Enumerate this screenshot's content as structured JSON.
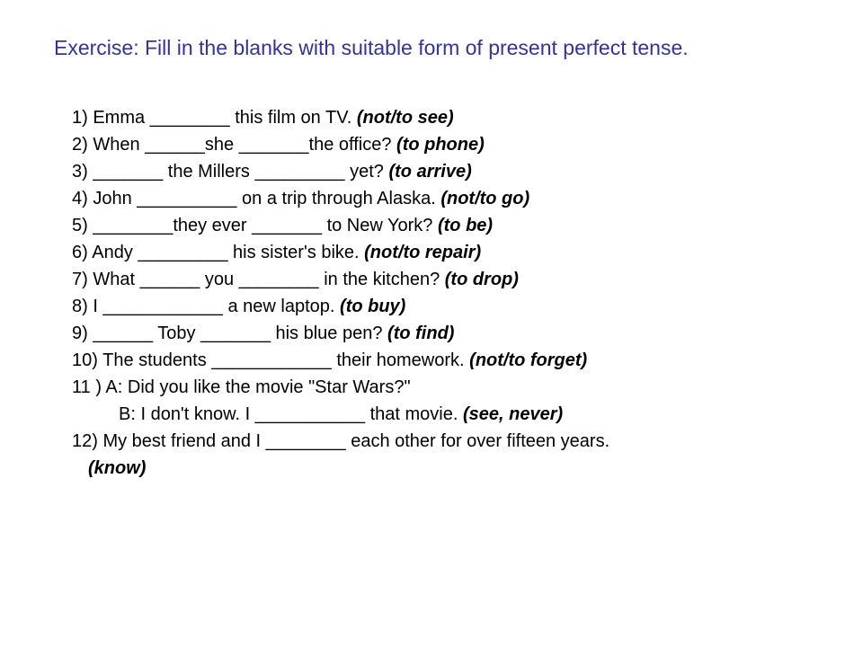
{
  "title": "Exercise: Fill in the blanks with suitable form of present perfect tense.",
  "items": {
    "q1": {
      "text": "1) Emma ________ this film on TV. ",
      "hint": "(not/to see)"
    },
    "q2": {
      "text": "2) When ______she _______the office? ",
      "hint": "(to phone)"
    },
    "q3": {
      "text": "3) _______ the Millers _________ yet? ",
      "hint": "(to arrive)"
    },
    "q4": {
      "text": "4) John __________ on a trip through Alaska. ",
      "hint": "(not/to go)"
    },
    "q5": {
      "text": "5) ________they ever _______ to New York? ",
      "hint": "(to be)"
    },
    "q6": {
      "text": "6) Andy _________ his sister's bike. ",
      "hint": "(not/to repair)"
    },
    "q7": {
      "text": "7) What ______ you ________ in the kitchen? ",
      "hint": "(to drop)"
    },
    "q8": {
      "text": "8) I ____________ a new laptop. ",
      "hint": "(to buy)"
    },
    "q9": {
      "text": "9) ______ Toby _______ his blue pen? ",
      "hint": "(to find)"
    },
    "q10": {
      "text": "10) The students ____________ their homework. ",
      "hint": "(not/to forget)"
    },
    "q11a": {
      "text": "11 )  A: Did you like the movie \"Star Wars?\""
    },
    "q11b": {
      "text": "B: I don't know. I ___________ that movie. ",
      "hint": "(see, never)"
    },
    "q12": {
      "text": "12)   My best friend and I ________ each other for over fifteen years.",
      "hint": "(know)"
    }
  }
}
